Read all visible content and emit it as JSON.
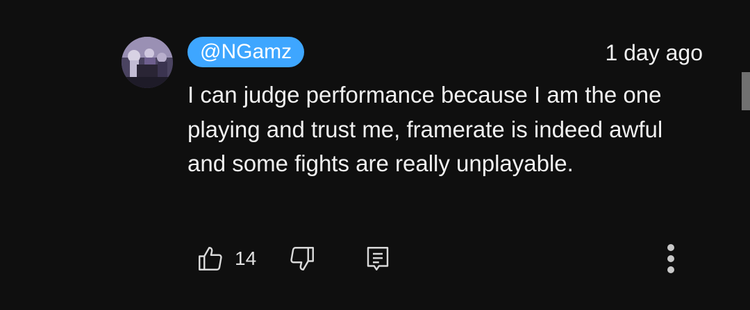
{
  "comment": {
    "author": "@NGamz",
    "timestamp": "1 day ago",
    "text": "I can judge performance because I am the one playing and trust me, framerate is indeed awful and some fights are really unplayable."
  },
  "actions": {
    "like_count": "14",
    "icons": {
      "like": "thumbs-up-icon",
      "dislike": "thumbs-down-icon",
      "reply": "reply-comment-icon",
      "more": "more-vertical-icon"
    }
  },
  "colors": {
    "background": "#0f0f0f",
    "author_chip": "#3ea6ff",
    "text": "#f1f1f1"
  }
}
